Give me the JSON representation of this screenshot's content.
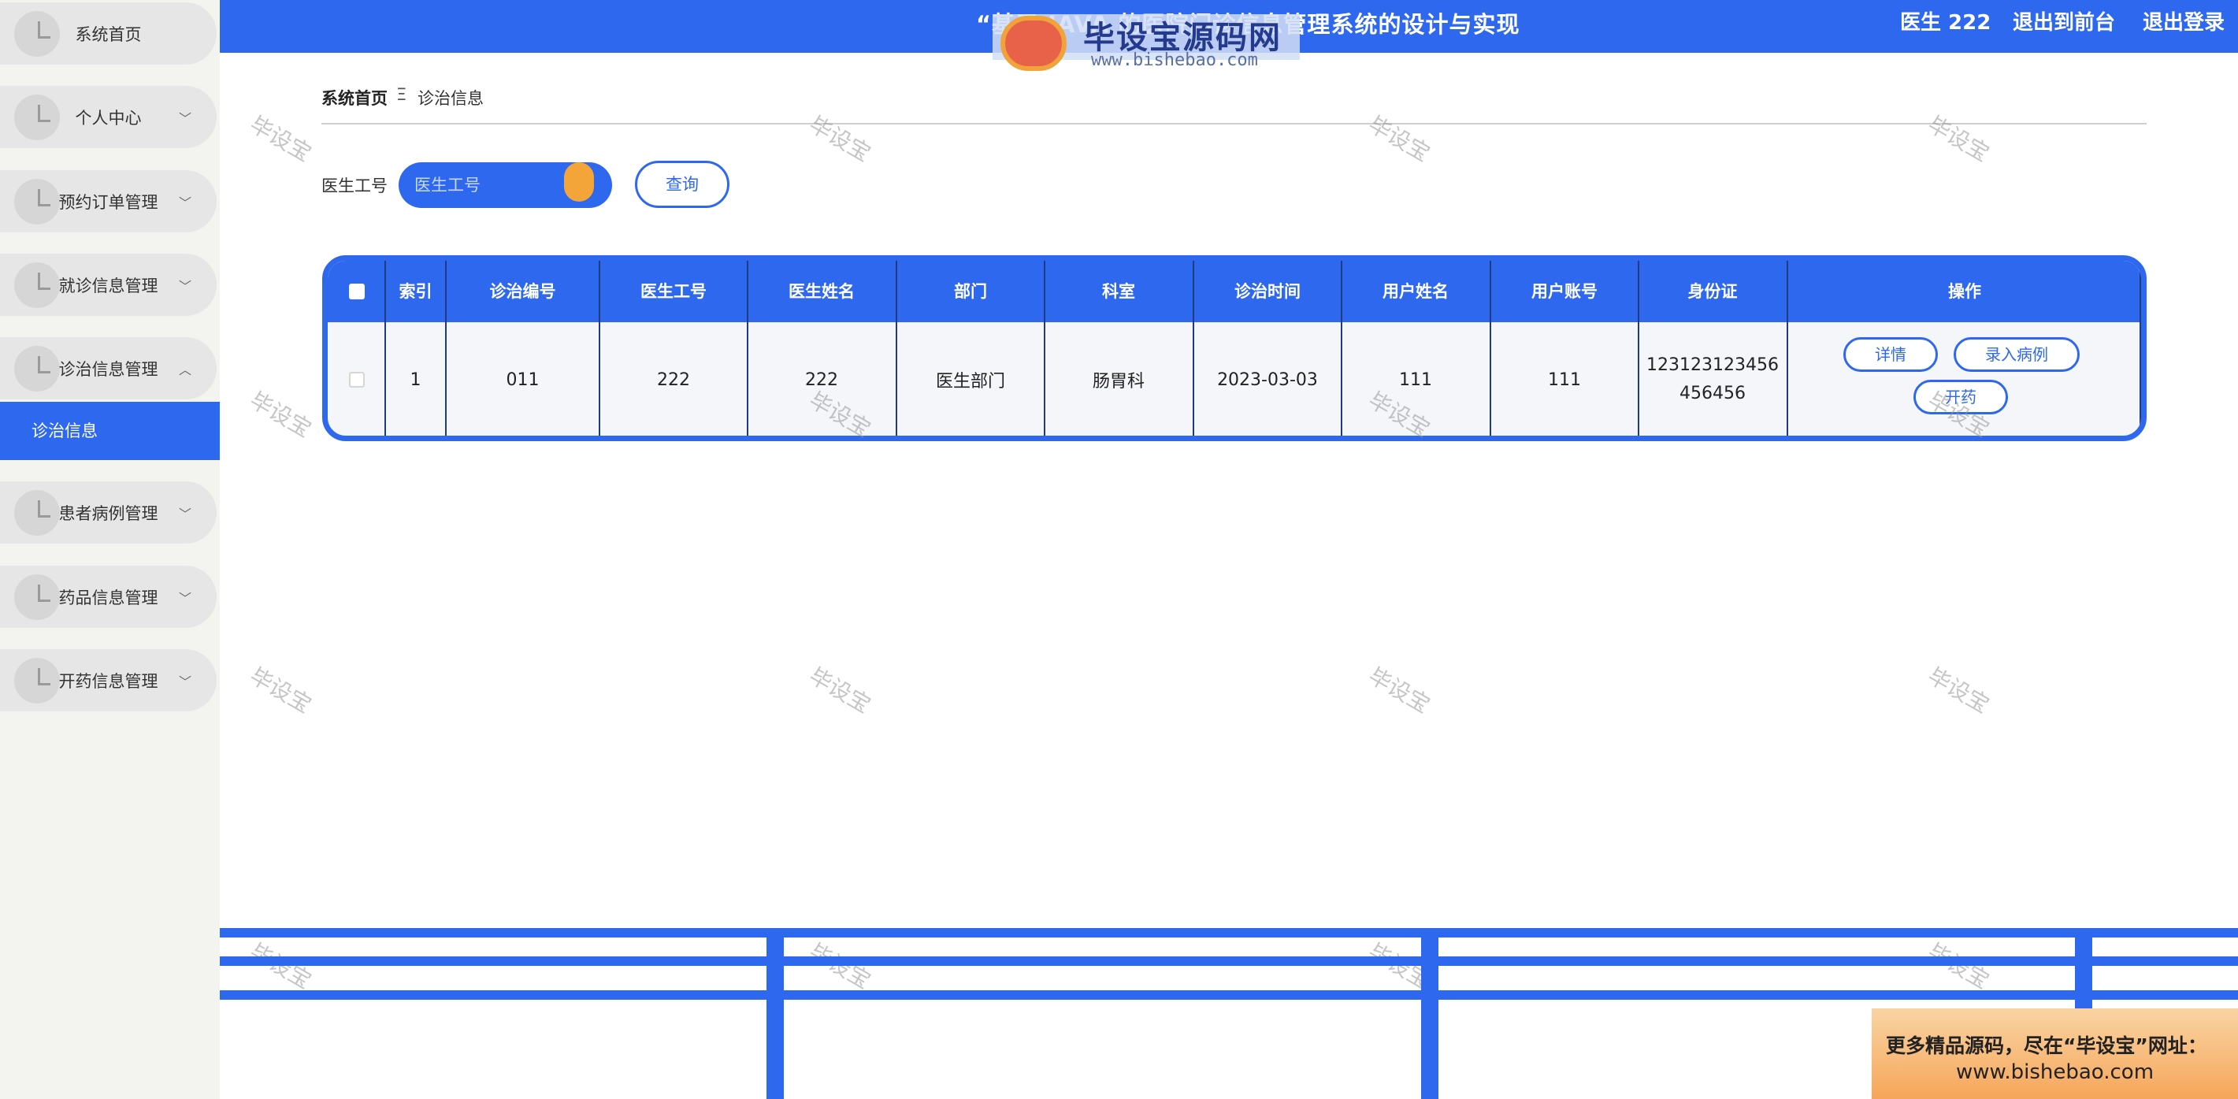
{
  "header": {
    "title": "“基于 JAVA 的医院门诊信息管理系统的设计与实现",
    "user": "医生 222",
    "back_front": "退出到前台",
    "logout": "退出登录"
  },
  "watermark": {
    "brand": "毕设宝源码网",
    "url": "www.bishebao.com",
    "tile_text": "毕设宝"
  },
  "sidebar": {
    "items": [
      {
        "label": "系统首页",
        "expandable": false
      },
      {
        "label": "个人中心",
        "expandable": true
      },
      {
        "label": "预约订单管理",
        "expandable": true
      },
      {
        "label": "就诊信息管理",
        "expandable": true
      },
      {
        "label": "诊治信息管理",
        "expandable": true,
        "expanded": true
      },
      {
        "label": "患者病例管理",
        "expandable": true
      },
      {
        "label": "药品信息管理",
        "expandable": true
      },
      {
        "label": "开药信息管理",
        "expandable": true
      }
    ],
    "active_sub": "诊治信息"
  },
  "breadcrumb": {
    "home": "系统首页",
    "separator": "Ξ",
    "current": "诊治信息"
  },
  "search": {
    "label": "医生工号",
    "placeholder": "医生工号",
    "value": "",
    "button": "查询"
  },
  "table": {
    "columns": [
      "索引",
      "诊治编号",
      "医生工号",
      "医生姓名",
      "部门",
      "科室",
      "诊治时间",
      "用户姓名",
      "用户账号",
      "身份证",
      "操作"
    ],
    "rows": [
      {
        "index": "1",
        "code": "011",
        "doctor_no": "222",
        "doctor_name": "222",
        "department": "医生部门",
        "office": "肠胃科",
        "time": "2023-03-03",
        "user_name": "111",
        "user_account": "111",
        "id_card_line1": "123123123456",
        "id_card_line2": "456456",
        "actions": {
          "detail": "详情",
          "record": "录入病例",
          "prescribe": "开药"
        }
      }
    ]
  },
  "ad": {
    "line1": "更多精品源码，尽在“毕设宝”网址：",
    "line2": "www.bishebao.com"
  },
  "colors": {
    "primary": "#2e68ee",
    "sidebar_bg": "#f3f3ef",
    "accent_orange": "#f4a53a"
  }
}
